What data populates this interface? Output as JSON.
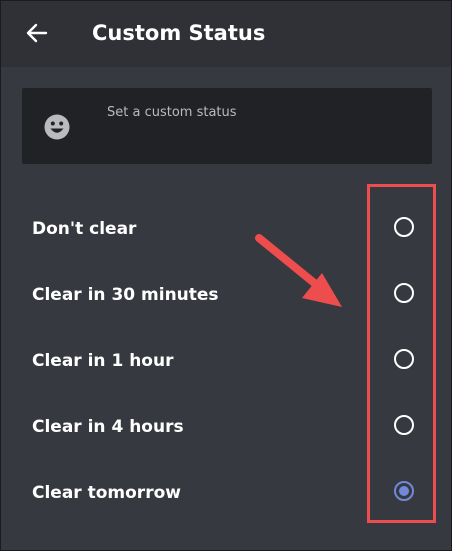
{
  "header": {
    "title": "Custom Status",
    "back_icon": "arrow-left-icon"
  },
  "status_input": {
    "placeholder": "Set a custom status",
    "emoji_icon": "smiley-face-icon"
  },
  "clear_options": [
    {
      "label": "Don't clear",
      "selected": false
    },
    {
      "label": "Clear in 30 minutes",
      "selected": false
    },
    {
      "label": "Clear in 1 hour",
      "selected": false
    },
    {
      "label": "Clear in 4 hours",
      "selected": false
    },
    {
      "label": "Clear tomorrow",
      "selected": true
    }
  ],
  "colors": {
    "background": "#36393f",
    "header": "#2f3136",
    "input_background": "#202225",
    "accent": "#7289da",
    "annotation": "#ee4d4d",
    "text": "#ffffff",
    "muted_text": "#b9bbbe"
  }
}
